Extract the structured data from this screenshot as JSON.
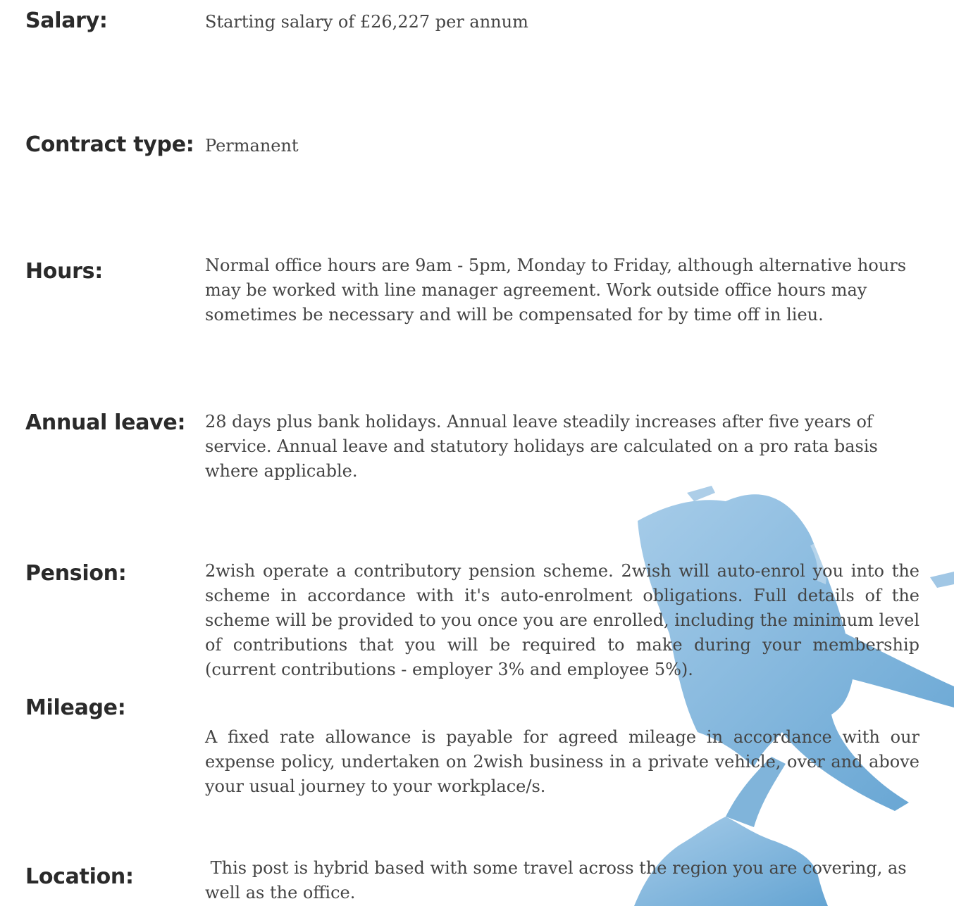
{
  "accent_color": "#4f93c7",
  "watermark": {
    "name": "brush-stroke-watermark"
  },
  "rows": [
    {
      "label": "Salary:",
      "value": "Starting salary of £26,227 per annum"
    },
    {
      "label": "Contract type:",
      "value": "Permanent"
    },
    {
      "label": "Hours:",
      "value": "Normal office hours are 9am - 5pm, Monday to Friday, although alternative hours may be worked with line manager agreement. Work outside office hours may sometimes be necessary and will be compensated for by time off in lieu."
    },
    {
      "label": "Annual leave:",
      "value": "28 days plus bank holidays. Annual leave steadily increases after five years of service. Annual leave and statutory holidays are calculated on a pro rata basis where applicable."
    },
    {
      "label": "Pension:",
      "value": "2wish operate a contributory pension scheme. 2wish will auto-enrol you into the scheme in accordance with it's auto-enrolment obligations. Full details of the scheme will be provided to you once you are enrolled, including the minimum level of contributions that you will be required to make during your membership (current contributions - employer 3% and employee 5%)."
    },
    {
      "label": "Mileage:",
      "value": "A fixed rate allowance is payable for agreed mileage in accordance with our expense policy, undertaken on 2wish business in a private vehicle, over and above your usual journey to your workplace/s."
    },
    {
      "label": "Location:",
      "value": " This post is hybrid based with some travel across the region you are covering, as well as the office."
    }
  ]
}
